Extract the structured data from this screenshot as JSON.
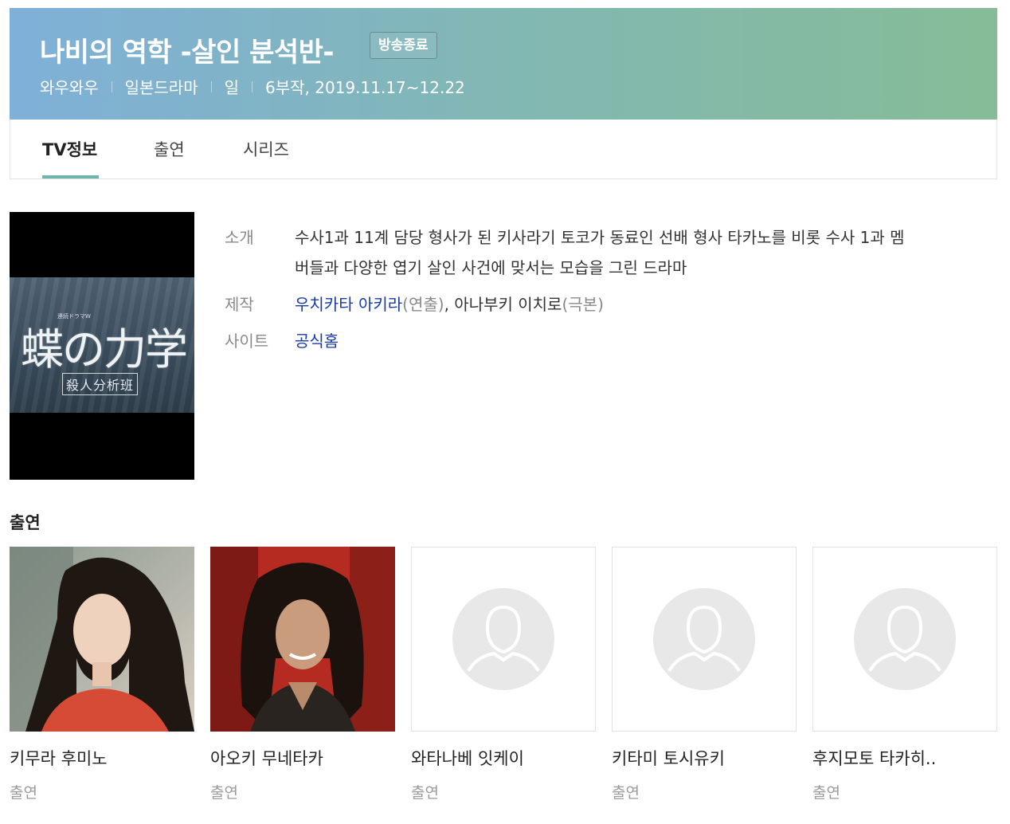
{
  "header": {
    "title": "나비의 역학 -살인 분석반-",
    "status_badge": "방송종료",
    "meta": [
      "와우와우",
      "일본드라마",
      "일",
      "6부작, 2019.11.17~12.22"
    ],
    "gradient_colors": [
      "#7fb0d9",
      "#86bc97"
    ]
  },
  "tabs": [
    {
      "label": "TV정보",
      "active": true
    },
    {
      "label": "출연",
      "active": false
    },
    {
      "label": "시리즈",
      "active": false
    }
  ],
  "poster": {
    "title_text": "蝶の力学",
    "subtitle_text": "殺人分析班",
    "tag_text": "連続ドラマW"
  },
  "info": {
    "intro_label": "소개",
    "intro_line1": "수사1과 11계 담당 형사가 된 키사라기 토코가 동료인 선배 형사 타카노를 비롯 수사 1과 멤",
    "intro_line2": "버들과 다양한 엽기 살인 사건에 맞서는 모습을 그린 드라마",
    "production_label": "제작",
    "director_name": "우치카타 아키라",
    "director_role": "(연출)",
    "production_sep": ", ",
    "writer_name": "아나부키 이치로",
    "writer_role": "(극본)",
    "site_label": "사이트",
    "site_link": "공식홈"
  },
  "cast_section": {
    "title": "출연",
    "members": [
      {
        "name": "키무라 후미노",
        "role": "출연",
        "photo": "photo"
      },
      {
        "name": "아오키 무네타카",
        "role": "출연",
        "photo": "photo"
      },
      {
        "name": "와타나베 잇케이",
        "role": "출연",
        "photo": "placeholder"
      },
      {
        "name": "키타미 토시유키",
        "role": "출연",
        "photo": "placeholder"
      },
      {
        "name": "후지모토 타카히..",
        "role": "출연",
        "photo": "placeholder"
      }
    ]
  },
  "colors": {
    "accent_tab": "#6cb6ac",
    "link": "#1a3aa8",
    "placeholder_bg": "#e8e8e8"
  }
}
